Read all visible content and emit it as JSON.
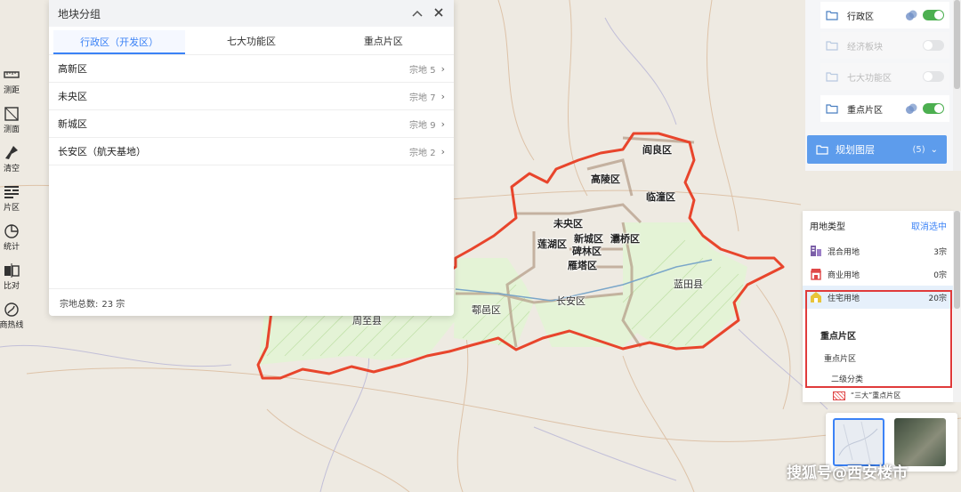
{
  "toolbar": {
    "items": [
      {
        "label": "测距",
        "icon": "ruler-icon"
      },
      {
        "label": "测面",
        "icon": "area-measure-icon"
      },
      {
        "label": "清空",
        "icon": "broom-icon"
      },
      {
        "label": "片区",
        "icon": "district-icon"
      },
      {
        "label": "统计",
        "icon": "pie-chart-icon"
      },
      {
        "label": "比对",
        "icon": "compare-icon"
      },
      {
        "label": "商热线",
        "icon": "heat-line-icon"
      }
    ]
  },
  "parcel_panel": {
    "title": "地块分组",
    "tabs": [
      {
        "label": "行政区（开发区）",
        "active": true
      },
      {
        "label": "七大功能区",
        "active": false
      },
      {
        "label": "重点片区",
        "active": false
      }
    ],
    "rows": [
      {
        "name": "高新区",
        "count": "宗地 5"
      },
      {
        "name": "未央区",
        "count": "宗地 7"
      },
      {
        "name": "新城区",
        "count": "宗地 9"
      },
      {
        "name": "长安区（航天基地）",
        "count": "宗地 2"
      }
    ],
    "footer_label": "宗地总数:",
    "footer_value": "23 宗"
  },
  "layer_panel": {
    "items": [
      {
        "label": "行政区",
        "enabled": true,
        "on": true
      },
      {
        "label": "经济板块",
        "enabled": false,
        "on": false
      },
      {
        "label": "七大功能区",
        "enabled": false,
        "on": false
      },
      {
        "label": "重点片区",
        "enabled": true,
        "on": true
      }
    ],
    "plan_layer": {
      "label": "规划图层",
      "count": "(5)"
    }
  },
  "land_panel": {
    "title": "用地类型",
    "clear": "取消选中",
    "rows": [
      {
        "label": "混合用地",
        "count": "3宗",
        "icon": "mixed-use-icon",
        "color": "#7b5ea7"
      },
      {
        "label": "商业用地",
        "count": "0宗",
        "icon": "shop-icon",
        "color": "#e04848"
      },
      {
        "label": "住宅用地",
        "count": "20宗",
        "icon": "house-icon",
        "color": "#e8c43a",
        "selected": true
      }
    ],
    "section_title": "重点片区",
    "sub1": "重点片区",
    "sub2": "二级分类",
    "legend": "“三大”重点片区"
  },
  "map_labels": {
    "yanliang": "阎良区",
    "gaoling": "高陵区",
    "lintong": "临潼区",
    "weiyang": "未央区",
    "xincheng": "新城区",
    "lianhu": "莲湖区",
    "baqiao": "灞桥区",
    "beilin": "碑林区",
    "yanta": "雁塔区",
    "chang_an": "长安区",
    "huyi": "鄠邑区",
    "lantian": "蓝田县",
    "zhouzhi": "周至县"
  },
  "watermark": "搜狐号@西安楼市",
  "colors": {
    "accent": "#3b82f6",
    "toggle_on": "#4caf50",
    "boundary": "#e8452c",
    "plan_layer": "#5d9cec"
  }
}
